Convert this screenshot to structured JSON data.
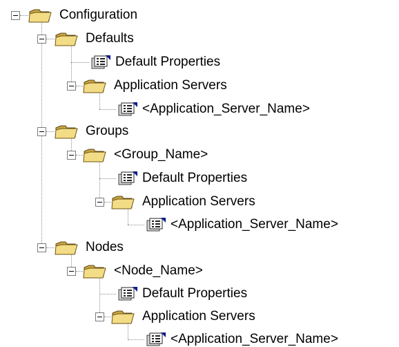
{
  "tree": {
    "root_label": "Configuration",
    "defaults_label": "Defaults",
    "defaults_properties_label": "Default Properties",
    "defaults_app_servers_label": "Application Servers",
    "defaults_app_server_name": "<Application_Server_Name>",
    "groups_label": "Groups",
    "group_name_label": "<Group_Name>",
    "group_properties_label": "Default Properties",
    "group_app_servers_label": "Application Servers",
    "group_app_server_name": "<Application_Server_Name>",
    "nodes_label": "Nodes",
    "node_name_label": "<Node_Name>",
    "node_properties_label": "Default Properties",
    "node_app_servers_label": "Application Servers",
    "node_app_server_name": "<Application_Server_Name>"
  },
  "icons": {
    "folder": "folder-icon",
    "properties": "properties-icon"
  },
  "colors": {
    "connector": "#8c8c8c",
    "folder_front": "#f3dc86",
    "folder_back": "#c9a544",
    "properties_accent": "#0a1a8c"
  }
}
